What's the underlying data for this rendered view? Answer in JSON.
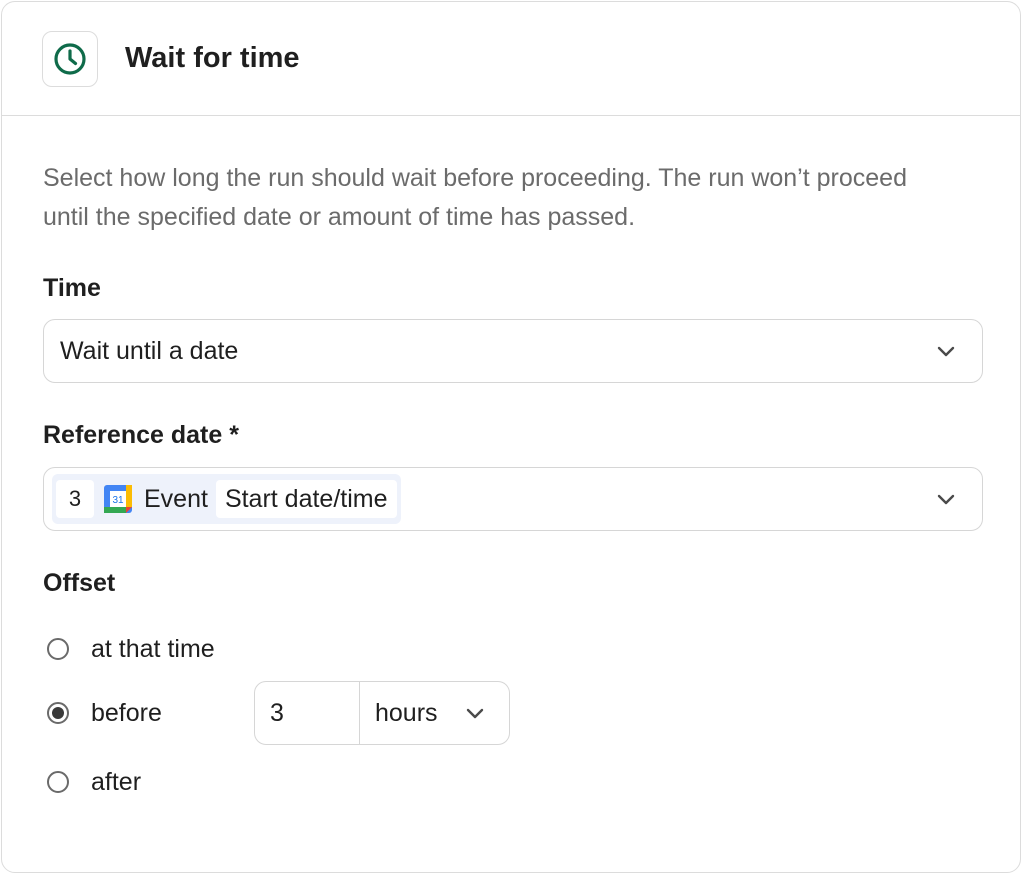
{
  "header": {
    "title": "Wait for time",
    "icon": "clock-icon",
    "icon_color": "#0f6b4a"
  },
  "description": "Select how long the run should wait before proceeding. The run won’t proceed until the specified date or amount of time has passed.",
  "time": {
    "label": "Time",
    "value": "Wait until a date"
  },
  "reference_date": {
    "label": "Reference date *",
    "step_number": "3",
    "app_icon": "google-calendar-icon",
    "app_label": "Event",
    "field_label": "Start date/time"
  },
  "offset": {
    "label": "Offset",
    "options": [
      {
        "label": "at that time",
        "checked": false
      },
      {
        "label": "before",
        "checked": true
      },
      {
        "label": "after",
        "checked": false
      }
    ],
    "amount": "3",
    "unit": "hours"
  }
}
